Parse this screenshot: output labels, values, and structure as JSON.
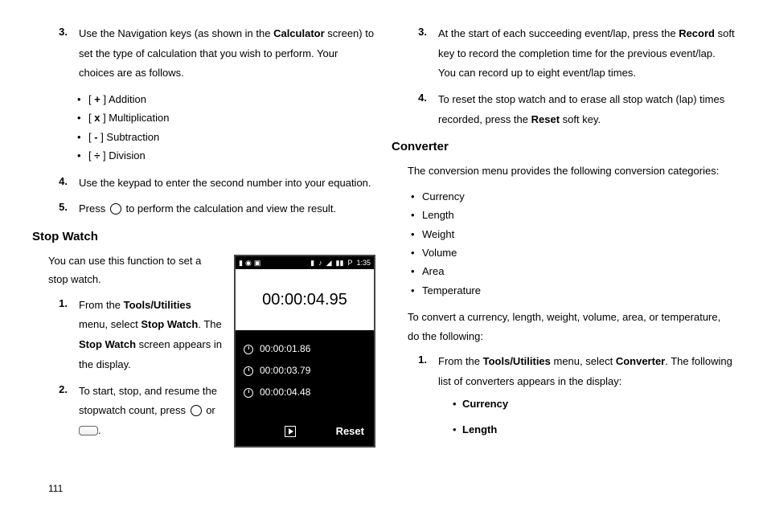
{
  "left": {
    "step3_pre": "Use the Navigation keys (as shown in the ",
    "step3_bold": "Calculator",
    "step3_post": " screen) to set the type of calculation that you wish to perform. Your choices are as follows.",
    "ops": {
      "add_sym": "+",
      "add_label": " ] Addition",
      "mul_sym": "x",
      "mul_label": " ] Multiplication",
      "sub_sym": "-",
      "sub_label": " ] Subtraction",
      "div_sym": "÷",
      "div_label": " ] Division"
    },
    "step4": "Use the keypad to enter the second number into your equation.",
    "step5_pre": "Press ",
    "step5_post": " to perform the calculation and view the result.",
    "sw_heading": "Stop Watch",
    "sw_intro": "You can use this function to set a stop watch.",
    "sw_step1_a": "From the ",
    "sw_step1_b": "Tools/Utilities",
    "sw_step1_c": " menu, select ",
    "sw_step1_d": "Stop Watch",
    "sw_step1_e": ". The ",
    "sw_step1_f": "Stop Watch",
    "sw_step1_g": " screen appears in the display.",
    "sw_step2_pre": "To start, stop, and resume the stopwatch count, press ",
    "sw_step2_mid": " or ",
    "sw_step2_post": "."
  },
  "phone": {
    "status_time": "1:35",
    "status_p": "P",
    "main_time": "00:00:04.95",
    "lap1": "00:00:01.86",
    "lap2": "00:00:03.79",
    "lap3": "00:00:04.48",
    "reset": "Reset"
  },
  "right": {
    "r3_a": "At the start of each succeeding event/lap, press the ",
    "r3_b": "Record",
    "r3_c": " soft key to record the completion time for the previous event/lap. You can record up to eight event/lap times.",
    "r4_a": "To reset the stop watch and to erase all stop watch (lap) times recorded, press the ",
    "r4_b": "Reset",
    "r4_c": " soft key.",
    "conv_heading": "Converter",
    "conv_intro": "The conversion menu provides the following conversion categories:",
    "cats": {
      "c1": "Currency",
      "c2": "Length",
      "c3": "Weight",
      "c4": "Volume",
      "c5": "Area",
      "c6": "Temperature"
    },
    "conv_proc": "To convert a currency, length, weight, volume, area, or temperature, do the following:",
    "c1_a": "From the ",
    "c1_b": "Tools/Utilities",
    "c1_c": " menu, select ",
    "c1_d": "Converter",
    "c1_e": ". The following list of converters appears in the display:",
    "sub": {
      "s1": "Currency",
      "s2": "Length"
    }
  },
  "nums": {
    "n3": "3.",
    "n4": "4.",
    "n5": "5.",
    "n1": "1.",
    "n2": "2."
  },
  "page": "111"
}
